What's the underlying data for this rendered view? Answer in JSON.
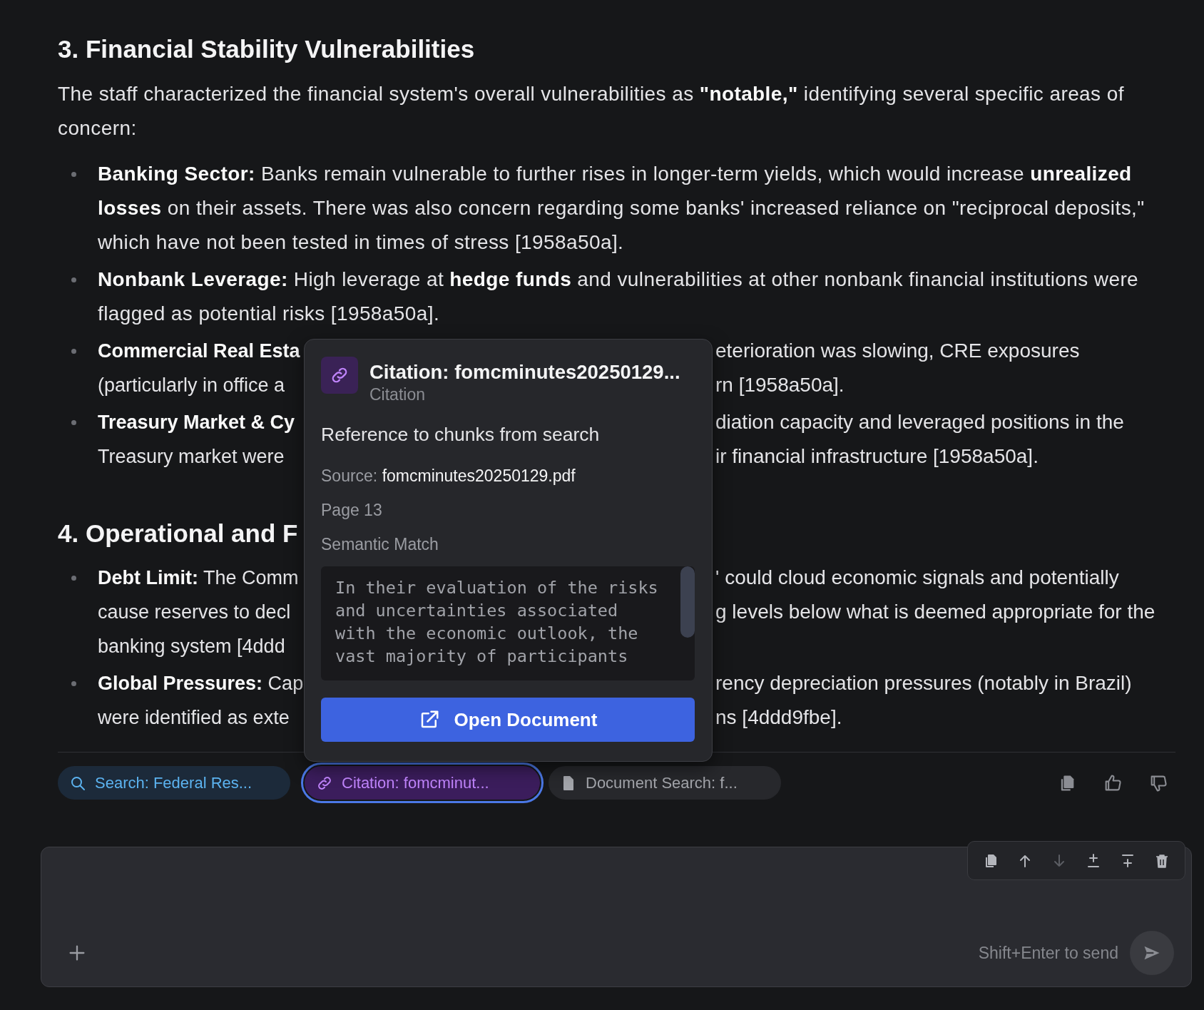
{
  "sections": [
    {
      "heading": "3. Financial Stability Vulnerabilities",
      "intro": "The staff characterized the financial system's overall vulnerabilities as **\"notable,\"** identifying several specific areas of concern:",
      "bullets": [
        {
          "label": "Banking Sector:",
          "text": "Banks remain vulnerable to further rises in longer-term yields, which would increase **unrealized losses** on their assets. There was also concern regarding some banks' increased reliance on \"reciprocal deposits,\" which have not been tested in times of stress [1958a50a]."
        },
        {
          "label": "Nonbank Leverage:",
          "text": "High leverage at **hedge funds** and vulnerabilities at other nonbank financial institutions were flagged as potential risks [1958a50a]."
        },
        {
          "label": "Commercial Real Esta",
          "lines": [
            {
              "right": "eterioration was slowing, CRE exposures"
            },
            {
              "left": "(particularly in office a",
              "right": "rn [1958a50a]."
            }
          ]
        },
        {
          "label": "Treasury Market & Cy",
          "lines": [
            {
              "right": "diation capacity and leveraged positions in the"
            },
            {
              "left": "Treasury market were",
              "right": "ir financial infrastructure [1958a50a]."
            }
          ]
        }
      ]
    },
    {
      "heading": "4. Operational and F",
      "bullets": [
        {
          "label": "Debt Limit:",
          "lines": [
            {
              "left": "The Comm",
              "right": "' could cloud economic signals and potentially"
            },
            {
              "left": "cause reserves to decl",
              "right": "g levels below what is deemed appropriate for the"
            },
            {
              "left": "banking system [4ddd"
            }
          ]
        },
        {
          "label": "Global Pressures:",
          "lines": [
            {
              "left": "Cap",
              "right": "rency depreciation pressures (notably in Brazil)"
            },
            {
              "left": "were identified as exte",
              "right": "ns [4ddd9fbe]."
            }
          ]
        }
      ]
    }
  ],
  "popup": {
    "title": "Citation: fomcminutes20250129...",
    "subtitle": "Citation",
    "description": "Reference to chunks from search",
    "source_label": "Source:",
    "source_value": "fomcminutes20250129.pdf",
    "page": "Page 13",
    "match": "Semantic Match",
    "excerpt": "In their evaluation of the risks\nand uncertainties associated\nwith the economic outlook, the\nvast majority of participants",
    "button": "Open Document"
  },
  "chips": [
    {
      "kind": "search",
      "label": "Search: Federal Res...",
      "selected": false
    },
    {
      "kind": "citation",
      "label": "Citation: fomcminut...",
      "selected": true
    },
    {
      "kind": "document",
      "label": "Document Search: f...",
      "selected": false
    }
  ],
  "toolbar": [
    {
      "kind": "copy",
      "disabled": false
    },
    {
      "kind": "up",
      "disabled": false
    },
    {
      "kind": "down",
      "disabled": true
    },
    {
      "kind": "insert-above",
      "disabled": false
    },
    {
      "kind": "insert-below",
      "disabled": false
    },
    {
      "kind": "delete",
      "disabled": false
    }
  ],
  "composer": {
    "hint": "Shift+Enter to send"
  }
}
